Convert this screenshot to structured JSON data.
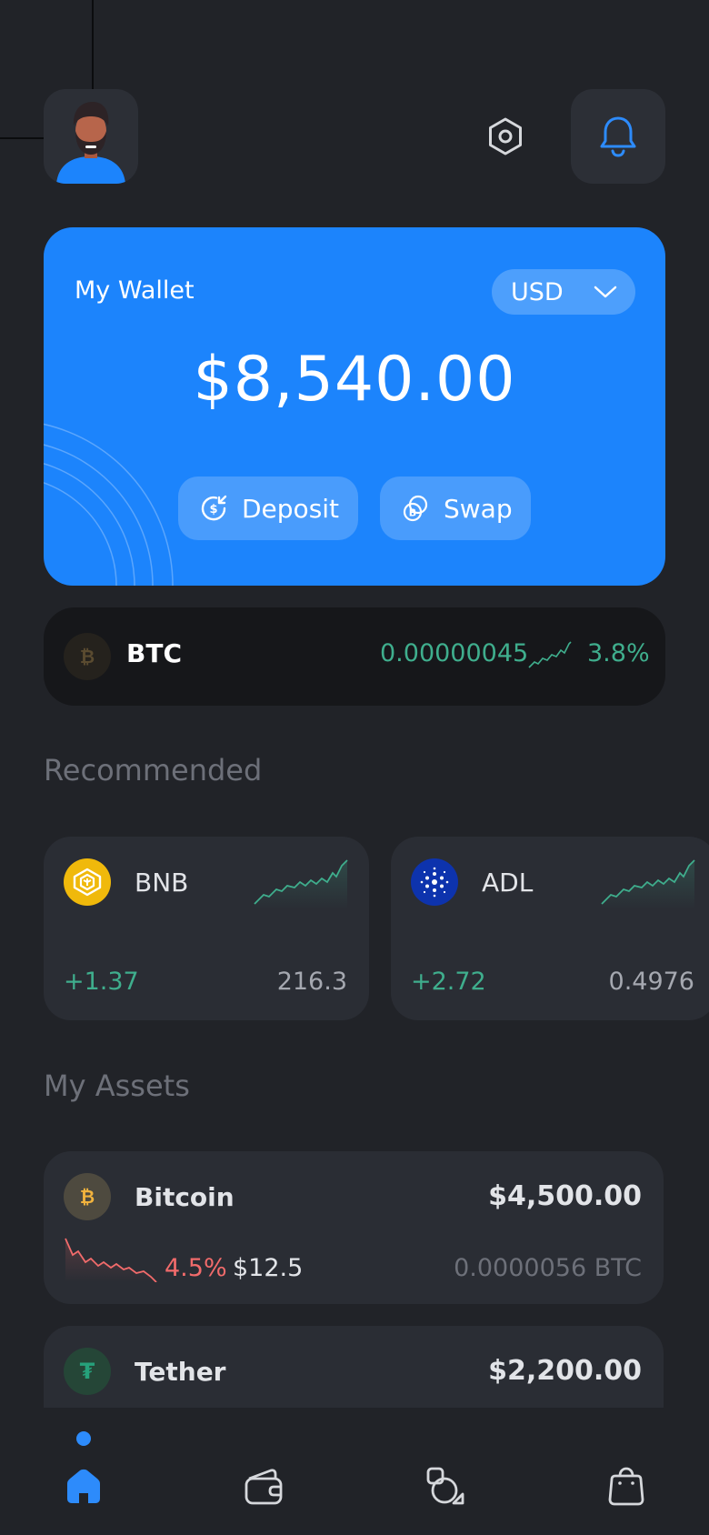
{
  "header": {
    "avatar_icon": "user-avatar",
    "settings_icon": "gear-icon",
    "bell_icon": "bell-icon"
  },
  "wallet": {
    "title": "My Wallet",
    "currency": "USD",
    "balance": "$8,540.00",
    "deposit_label": "Deposit",
    "swap_label": "Swap",
    "card_color": "#1c84fc"
  },
  "ticker": {
    "symbol": "BTC",
    "value": "0.00000045",
    "change": "3.8%",
    "trend": "up"
  },
  "recommended": {
    "title": "Recommended",
    "items": [
      {
        "name": "BNB",
        "change": "+1.37",
        "price": "216.3",
        "icon": "bnb-coin-icon"
      },
      {
        "name": "ADL",
        "change": "+2.72",
        "price": "0.4976",
        "icon": "cardano-coin-icon"
      }
    ]
  },
  "assets": {
    "title": "My Assets",
    "items": [
      {
        "name": "Bitcoin",
        "value": "$4,500.00",
        "change": "4.5%",
        "price": "$12.5",
        "amount": "0.0000056 BTC",
        "trend": "down",
        "icon": "bitcoin-icon"
      },
      {
        "name": "Tether",
        "value": "$2,200.00",
        "icon": "tether-icon"
      }
    ]
  },
  "nav": {
    "items": [
      "home",
      "wallet",
      "markets",
      "shop"
    ],
    "active": "home"
  },
  "colors": {
    "background": "#212328",
    "accent": "#1c84fc",
    "positive": "#3fae8d",
    "negative": "#f26b6b"
  }
}
